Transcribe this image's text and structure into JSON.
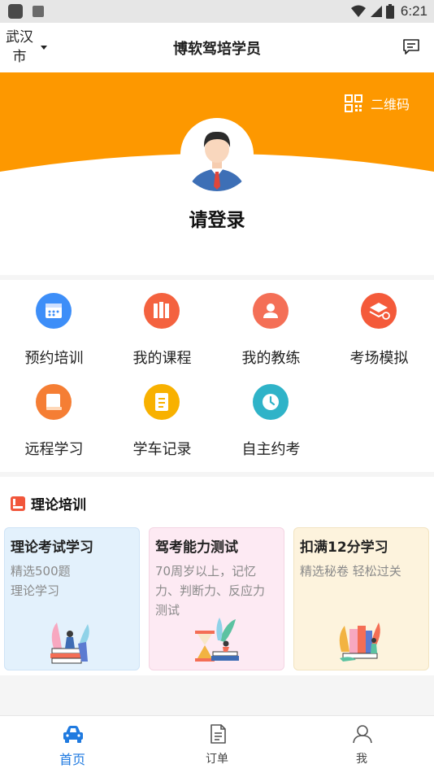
{
  "status_bar": {
    "time": "6:21",
    "left_icons": [
      "notification-icon",
      "a-icon"
    ],
    "right_icons": [
      "wifi-icon",
      "signal-icon",
      "battery-icon"
    ]
  },
  "header": {
    "city": "武汉市",
    "title": "博软驾培学员",
    "right_icon": "message-icon"
  },
  "hero": {
    "accent_color": "#fd9800",
    "qr_label": "二维码",
    "login_text": "请登录"
  },
  "services": [
    {
      "label": "预约培训",
      "icon": "calendar-icon",
      "color": "#3d8ef8"
    },
    {
      "label": "我的课程",
      "icon": "course-icon",
      "color": "#f4623f"
    },
    {
      "label": "我的教练",
      "icon": "coach-icon",
      "color": "#f46f56"
    },
    {
      "label": "考场模拟",
      "icon": "exam-sim-icon",
      "color": "#f45a3a"
    },
    {
      "label": "远程学习",
      "icon": "book-icon",
      "color": "#f57e34"
    },
    {
      "label": "学车记录",
      "icon": "record-icon",
      "color": "#f8b100"
    },
    {
      "label": "自主约考",
      "icon": "self-exam-icon",
      "color": "#2fb3c8"
    }
  ],
  "theory": {
    "section_title": "理论培训",
    "cards": [
      {
        "title": "理论考试学习",
        "desc": [
          "精选500题",
          "理论学习"
        ],
        "bg": "#e3f1fc"
      },
      {
        "title": "驾考能力测试",
        "desc": [
          "70周岁以上，记忆",
          "力、判断力、反应力",
          "测试"
        ],
        "bg": "#fdeaf3"
      },
      {
        "title": "扣满12分学习",
        "desc": [
          "精选秘卷 轻松过关"
        ],
        "bg": "#fdf3dd"
      }
    ]
  },
  "bottom_nav": [
    {
      "label": "首页",
      "icon": "car-icon",
      "active": true
    },
    {
      "label": "订单",
      "icon": "order-icon",
      "active": false
    },
    {
      "label": "我",
      "icon": "user-icon",
      "active": false
    }
  ]
}
